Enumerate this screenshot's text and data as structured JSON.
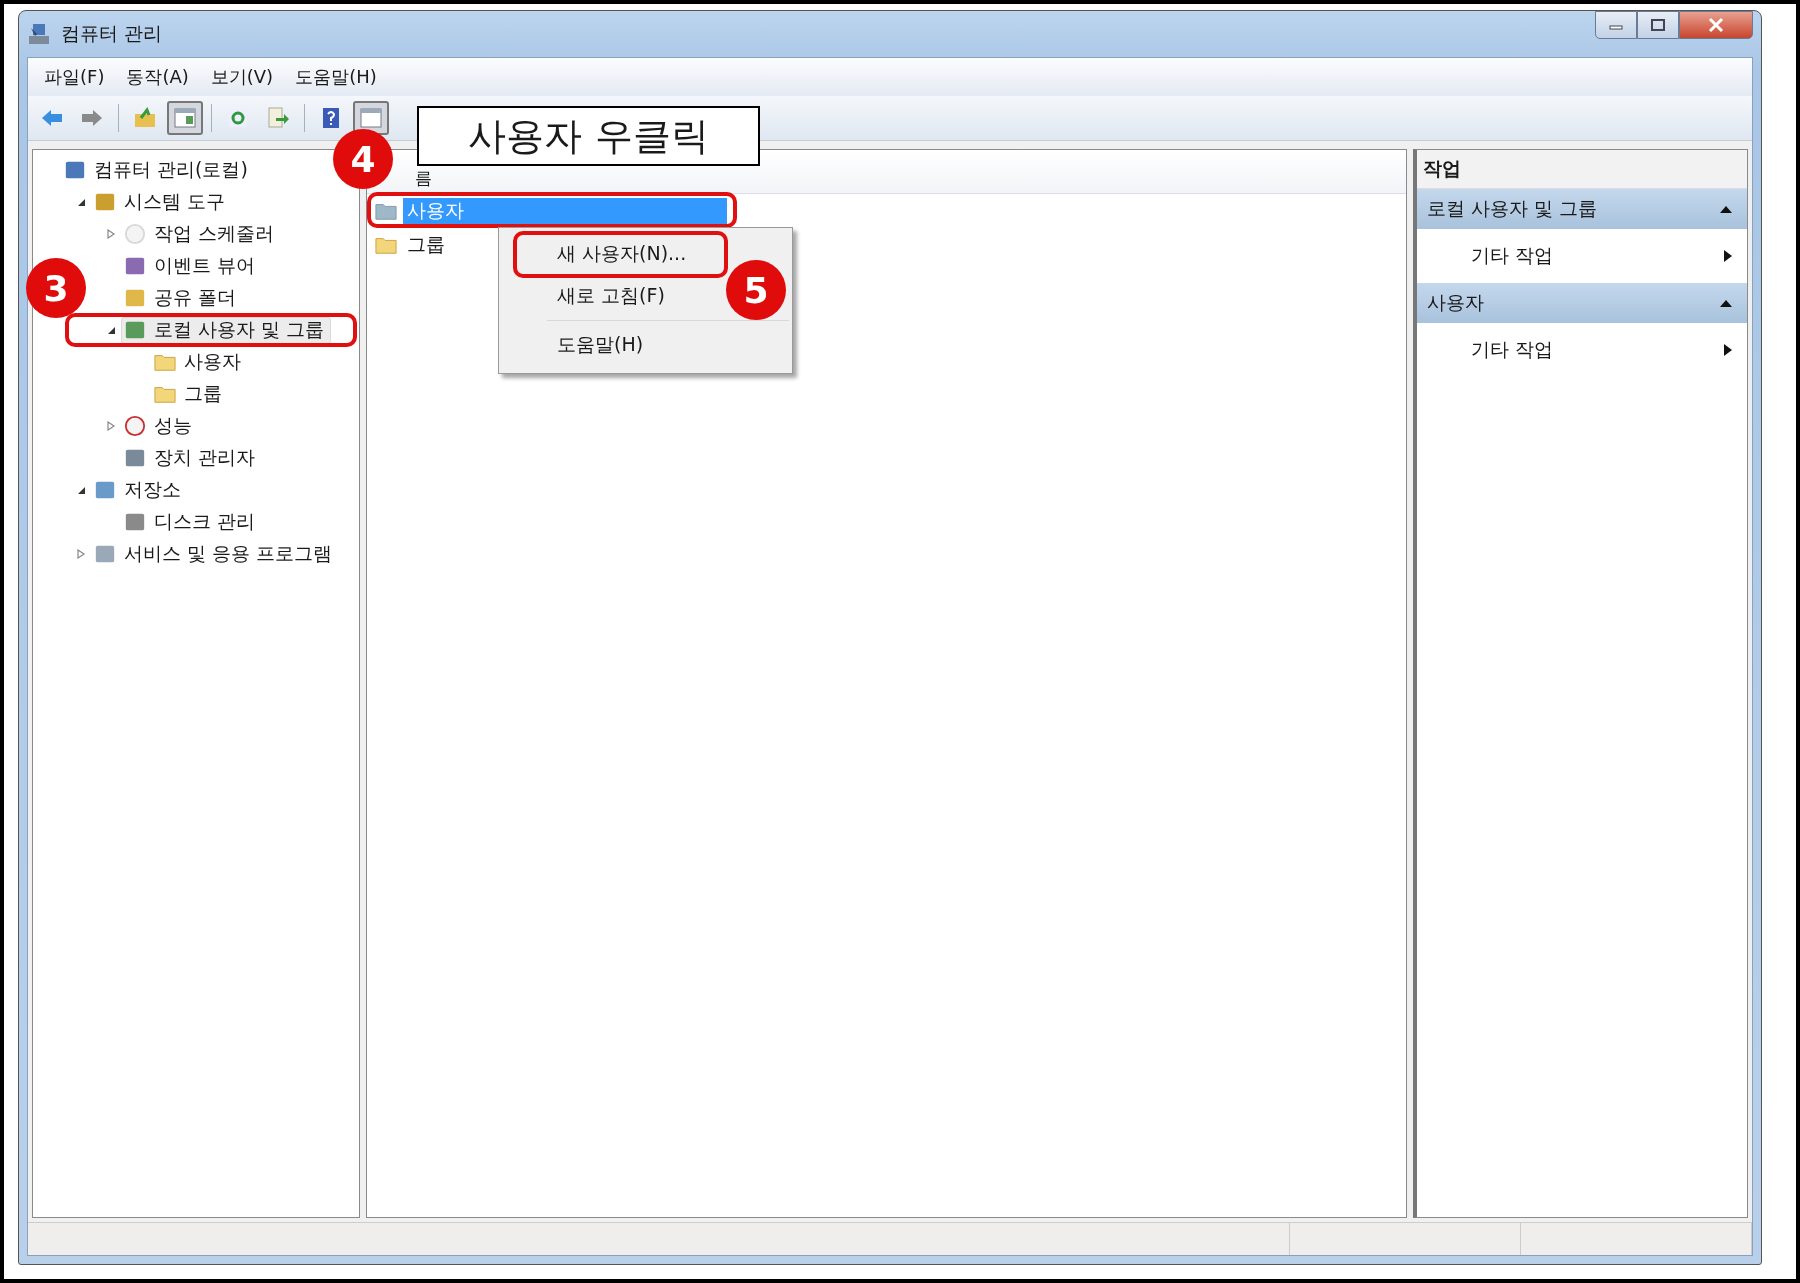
{
  "window": {
    "title": "컴퓨터 관리"
  },
  "menu": [
    "파일(F)",
    "동작(A)",
    "보기(V)",
    "도움말(H)"
  ],
  "toolbar": [
    {
      "kind": "back",
      "pressed": false
    },
    {
      "kind": "forward",
      "pressed": false
    },
    {
      "kind": "separator"
    },
    {
      "kind": "up",
      "pressed": false
    },
    {
      "kind": "tree",
      "pressed": true
    },
    {
      "kind": "separator"
    },
    {
      "kind": "refresh",
      "pressed": false
    },
    {
      "kind": "export",
      "pressed": false
    },
    {
      "kind": "separator"
    },
    {
      "kind": "help",
      "pressed": false
    },
    {
      "kind": "pane",
      "pressed": true
    }
  ],
  "tree": [
    {
      "label": "컴퓨터 관리(로컬)",
      "kind": "computer",
      "selected": false,
      "children": [
        {
          "label": "시스템 도구",
          "kind": "tools",
          "expanded": true,
          "selected": false,
          "children": [
            {
              "label": "작업 스케줄러",
              "kind": "clock",
              "expanded": false,
              "selected": false
            },
            {
              "label": "이벤트 뷰어",
              "kind": "event",
              "selected": false
            },
            {
              "label": "공유 폴더",
              "kind": "share",
              "selected": false
            },
            {
              "label": "로컬 사용자 및 그룹",
              "kind": "users",
              "expanded": true,
              "selected": true,
              "children": [
                {
                  "label": "사용자",
                  "kind": "folder",
                  "selected": false
                },
                {
                  "label": "그룹",
                  "kind": "folder",
                  "selected": false
                }
              ]
            },
            {
              "label": "성능",
              "kind": "perf",
              "expanded": false,
              "selected": false
            },
            {
              "label": "장치 관리자",
              "kind": "device",
              "selected": false
            }
          ]
        },
        {
          "label": "저장소",
          "kind": "storage",
          "expanded": true,
          "selected": false,
          "children": [
            {
              "label": "디스크 관리",
              "kind": "disk",
              "selected": false
            }
          ]
        },
        {
          "label": "서비스 및 응용 프로그램",
          "kind": "services",
          "expanded": false,
          "selected": false
        }
      ]
    }
  ],
  "list": {
    "column": "름",
    "rows": [
      {
        "name": "사용자",
        "selected": true
      },
      {
        "name": "그룹",
        "selected": false
      }
    ]
  },
  "context_menu": [
    {
      "kind": "item",
      "label": "새 사용자(N)..."
    },
    {
      "kind": "item",
      "label": "새로 고침(F)"
    },
    {
      "kind": "separator"
    },
    {
      "kind": "item",
      "label": "도움말(H)"
    }
  ],
  "actions": {
    "title": "작업",
    "sections": [
      {
        "title": "로컬 사용자 및 그룹",
        "items": [
          "기타 작업"
        ]
      },
      {
        "title": "사용자",
        "items": [
          "기타 작업"
        ]
      }
    ]
  },
  "annotations": {
    "steps": [
      "3",
      "4",
      "5"
    ],
    "callout": "사용자 우클릭"
  }
}
